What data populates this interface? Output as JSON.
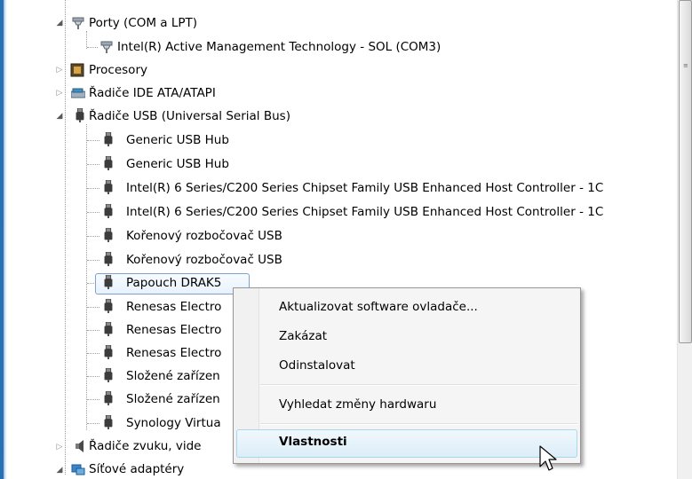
{
  "tree": [
    {
      "label": "Porty (COM a LPT)",
      "icon": "port-icon",
      "state": "expanded"
    },
    {
      "label": "Intel(R) Active Management Technology - SOL (COM3)",
      "icon": "port-icon"
    },
    {
      "label": "Procesory",
      "icon": "processor-icon",
      "state": "collapsed"
    },
    {
      "label": "Řadiče IDE ATA/ATAPI",
      "icon": "ide-controller-icon",
      "state": "collapsed"
    },
    {
      "label": "Řadiče USB (Universal Serial Bus)",
      "icon": "usb-icon",
      "state": "expanded"
    },
    {
      "label": "Generic USB Hub",
      "icon": "usb-icon"
    },
    {
      "label": "Generic USB Hub",
      "icon": "usb-icon"
    },
    {
      "label": "Intel(R) 6 Series/C200 Series Chipset Family USB Enhanced Host Controller - 1C",
      "icon": "usb-icon"
    },
    {
      "label": "Intel(R) 6 Series/C200 Series Chipset Family USB Enhanced Host Controller - 1C",
      "icon": "usb-icon"
    },
    {
      "label": "Kořenový rozbočovač USB",
      "icon": "usb-icon"
    },
    {
      "label": "Kořenový rozbočovač USB",
      "icon": "usb-icon"
    },
    {
      "label": "Papouch DRAK5",
      "icon": "usb-icon",
      "selected": true
    },
    {
      "label": "Renesas Electro",
      "icon": "usb-icon"
    },
    {
      "label": "Renesas Electro",
      "icon": "usb-icon"
    },
    {
      "label": "Renesas Electro",
      "icon": "usb-icon"
    },
    {
      "label": "Složené zařízen",
      "icon": "usb-icon"
    },
    {
      "label": "Složené zařízen",
      "icon": "usb-icon"
    },
    {
      "label": "Synology Virtua",
      "icon": "usb-icon"
    },
    {
      "label": "Řadiče zvuku, vide",
      "icon": "speaker-icon",
      "state": "collapsed"
    },
    {
      "label": "Síťové adaptéry",
      "icon": "network-adapter-icon",
      "state": "expanded"
    }
  ],
  "context_menu": {
    "update_driver": "Aktualizovat software ovladače...",
    "disable": "Zakázat",
    "uninstall": "Odinstalovat",
    "scan_hardware": "Vyhledat změny hardwaru",
    "properties": "Vlastnosti",
    "hovered_item": "Vlastnosti"
  },
  "scrollbar": {
    "grip_icon": "scrollbar-grip-icon"
  }
}
